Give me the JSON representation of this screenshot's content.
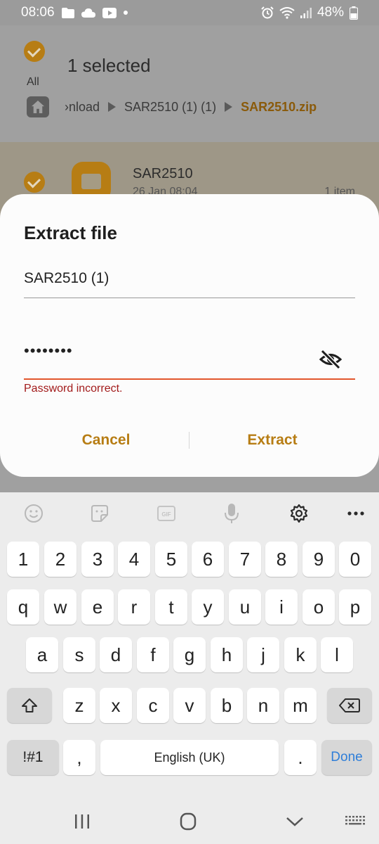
{
  "status": {
    "time": "08:06",
    "battery": "48%"
  },
  "header": {
    "all_label": "All",
    "selected_text": "1 selected"
  },
  "breadcrumb": {
    "seg1": "›nload",
    "seg2": "SAR2510 (1) (1)",
    "current": "SAR2510.zip"
  },
  "file": {
    "name": "SAR2510",
    "date": "26 Jan 08:04",
    "count": "1 item"
  },
  "dialog": {
    "title": "Extract file",
    "folder_name": "SAR2510 (1)",
    "password_dots": "••••••••",
    "error": "Password incorrect.",
    "cancel": "Cancel",
    "extract": "Extract"
  },
  "keyboard": {
    "row_numbers": [
      "1",
      "2",
      "3",
      "4",
      "5",
      "6",
      "7",
      "8",
      "9",
      "0"
    ],
    "row_top": [
      "q",
      "w",
      "e",
      "r",
      "t",
      "y",
      "u",
      "i",
      "o",
      "p"
    ],
    "row_mid": [
      "a",
      "s",
      "d",
      "f",
      "g",
      "h",
      "j",
      "k",
      "l"
    ],
    "row_bot": [
      "z",
      "x",
      "c",
      "v",
      "b",
      "n",
      "m"
    ],
    "symbols": "!#1",
    "comma": ",",
    "space": "English (UK)",
    "period": ".",
    "done": "Done"
  },
  "colors": {
    "accent": "#b77d14",
    "error": "#a21b1b",
    "underline_error": "#e2562c",
    "done_blue": "#2f7ed8"
  }
}
